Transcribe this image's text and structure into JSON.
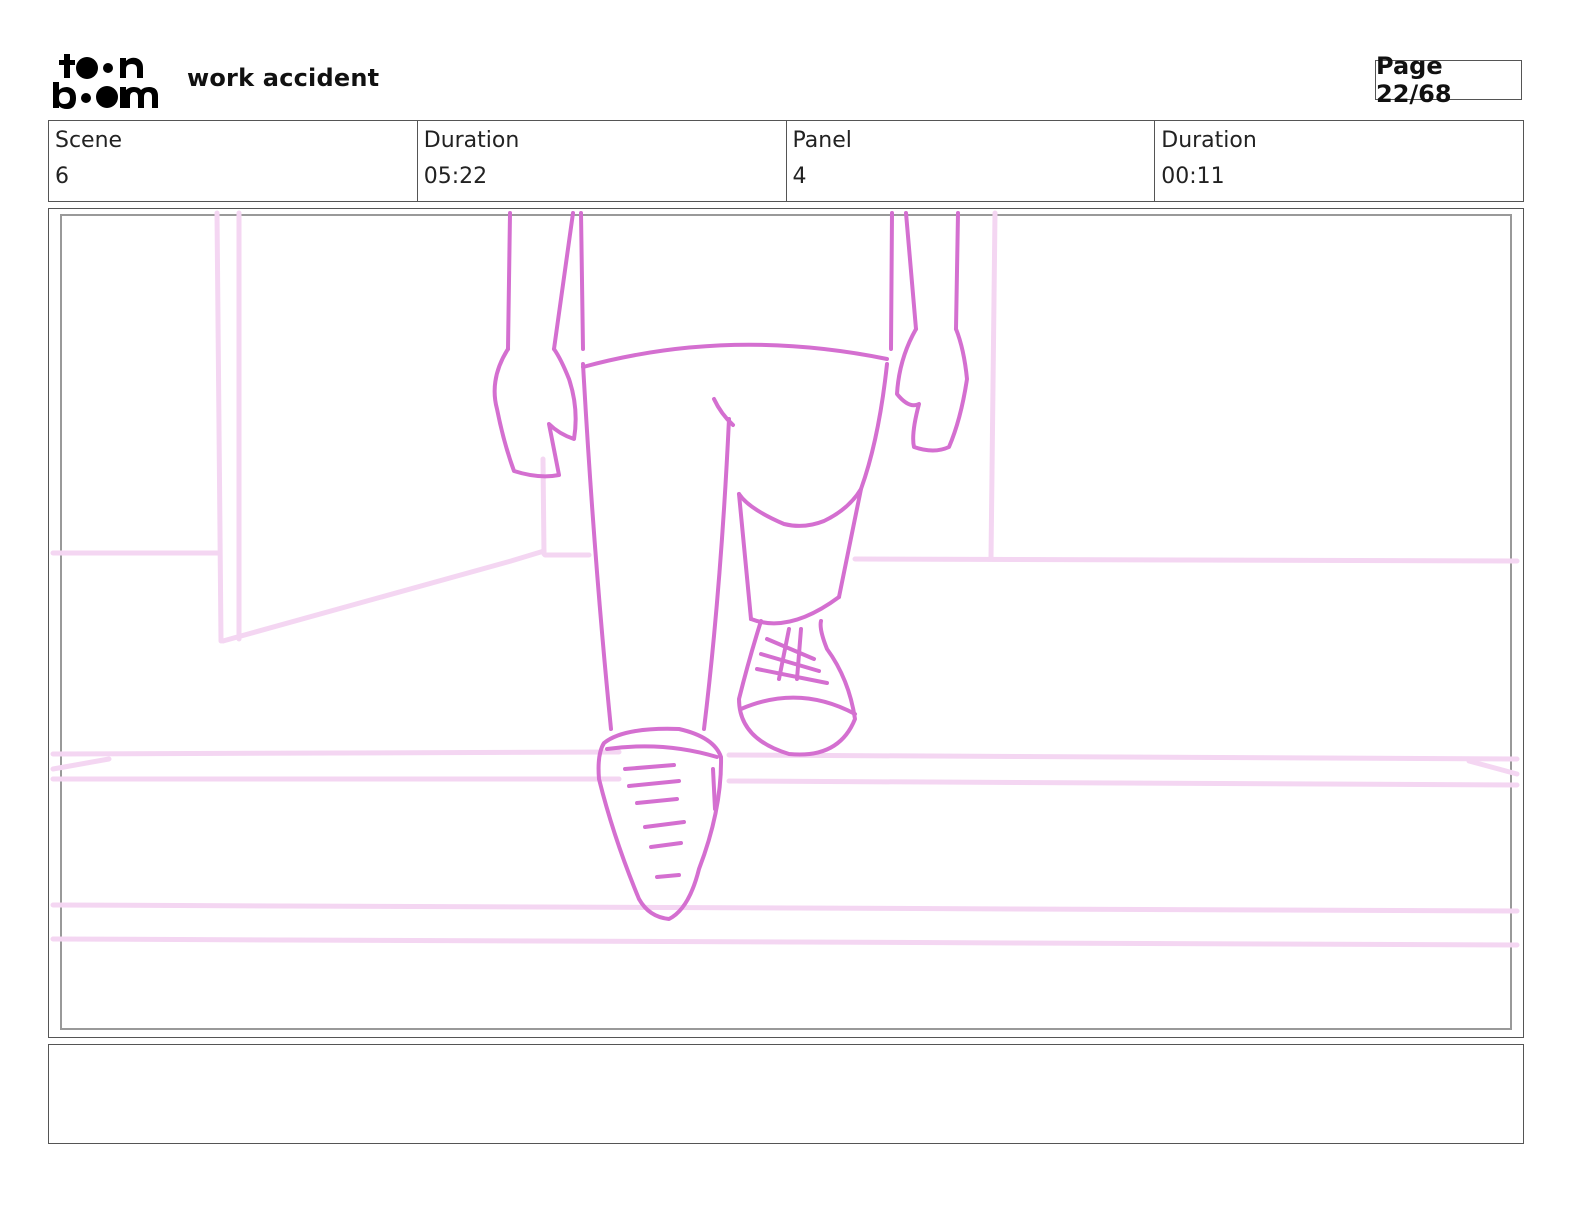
{
  "header": {
    "logo_text": "toon boom",
    "project_title": "work accident",
    "page_label": "Page 22/68"
  },
  "info": {
    "scene_label": "Scene",
    "scene_value": "6",
    "scene_duration_label": "Duration",
    "scene_duration_value": "05:22",
    "panel_label": "Panel",
    "panel_value": "4",
    "panel_duration_label": "Duration",
    "panel_duration_value": "00:11"
  },
  "sketch": {
    "description_color": "#d46fd0",
    "background_line_color": "#f4d6f2"
  },
  "notes": {
    "text": ""
  }
}
